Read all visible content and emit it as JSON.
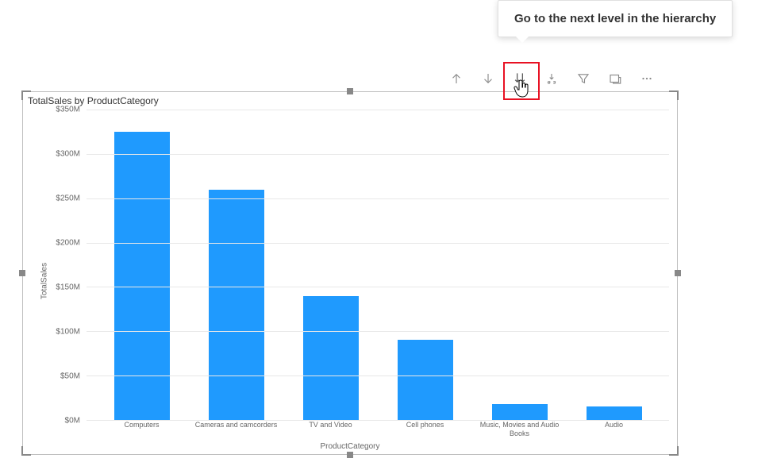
{
  "tooltip": "Go to the next level in the hierarchy",
  "chart_title": "TotalSales by ProductCategory",
  "y_axis_label": "TotalSales",
  "x_axis_label": "ProductCategory",
  "y_ticks": [
    "$350M",
    "$300M",
    "$250M",
    "$200M",
    "$150M",
    "$100M",
    "$50M",
    "$0M"
  ],
  "chart_data": {
    "type": "bar",
    "title": "TotalSales by ProductCategory",
    "xlabel": "ProductCategory",
    "ylabel": "TotalSales",
    "ylim": [
      0,
      350
    ],
    "categories": [
      "Computers",
      "Cameras and camcorders",
      "TV and Video",
      "Cell phones",
      "Music, Movies and Audio Books",
      "Audio"
    ],
    "values": [
      325,
      260,
      140,
      90,
      18,
      15
    ],
    "unit": "$M"
  }
}
